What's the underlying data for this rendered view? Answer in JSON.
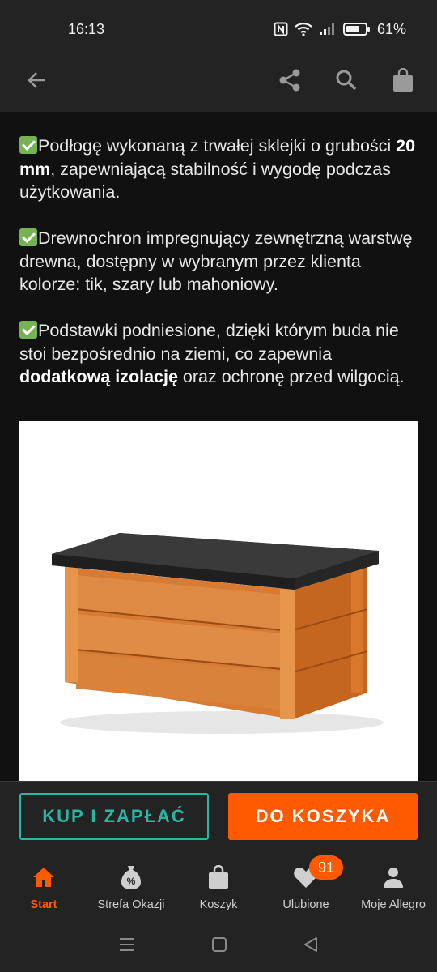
{
  "status_bar": {
    "time": "16:13",
    "battery": "61%"
  },
  "app_bar": {
    "icons": [
      "back-arrow-icon",
      "share-icon",
      "search-icon",
      "shopping-bag-icon"
    ]
  },
  "content": {
    "paragraphs": [
      {
        "p1": "Podłogę wykonaną z trwałej sklejki o grubości ",
        "b1": "20 mm",
        "p2": ", zapewniającą stabilność i wygodę podczas użytkowania."
      },
      {
        "p1": "Drewnochron impregnujący zewnętrzną warstwę drewna, dostępny w wybranym przez klienta kolorze: tik, szary lub mahoniowy."
      },
      {
        "p1": "Podstawki podniesione, dzięki którym buda nie stoi bezpośrednio na ziemi, co zapewnia ",
        "b1": "dodatkową izolację",
        "p2": " oraz ochronę przed wilgocią."
      }
    ]
  },
  "actions": {
    "buy_label": "KUP I ZAPŁAĆ",
    "cart_label": "DO KOSZYKA"
  },
  "bottom_nav": {
    "items": [
      {
        "label": "Start",
        "icon": "home-icon",
        "active": true
      },
      {
        "label": "Strefa Okazji",
        "icon": "deals-icon"
      },
      {
        "label": "Koszyk",
        "icon": "cart-bag-icon"
      },
      {
        "label": "Ulubione",
        "icon": "heart-icon",
        "badge": "91"
      },
      {
        "label": "Moje Allegro",
        "icon": "user-icon"
      }
    ]
  },
  "colors": {
    "accent": "#ff5a00",
    "teal": "#2bb5a3",
    "background": "#232323"
  }
}
